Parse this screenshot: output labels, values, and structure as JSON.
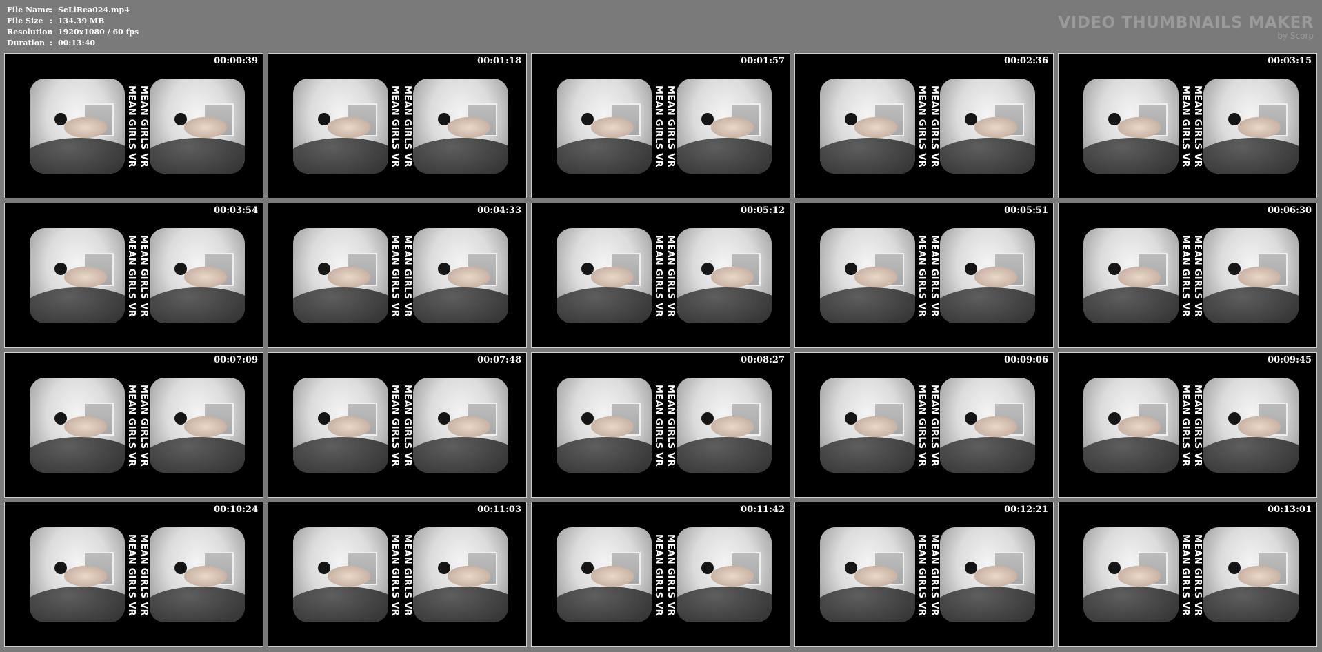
{
  "meta": {
    "rows": [
      {
        "key": "File Name",
        "sep": ":",
        "value": "SeLiRea024.mp4"
      },
      {
        "key": "File Size",
        "sep": ":",
        "value": "134.39 MB"
      },
      {
        "key": "Resolution",
        "sep": ":",
        "value": "1920x1080 / 60 fps"
      },
      {
        "key": "Duration",
        "sep": ":",
        "value": "00:13:40"
      }
    ]
  },
  "brand": {
    "title": "VIDEO THUMBNAILS MAKER",
    "subtitle": "by Scorp"
  },
  "thumbnails": [
    {
      "time": "00:00:39",
      "watermark": "MEAN GIRLS VR"
    },
    {
      "time": "00:01:18",
      "watermark": "MEAN GIRLS VR"
    },
    {
      "time": "00:01:57",
      "watermark": "MEAN GIRLS VR"
    },
    {
      "time": "00:02:36",
      "watermark": "MEAN GIRLS VR"
    },
    {
      "time": "00:03:15",
      "watermark": "MEAN GIRLS VR"
    },
    {
      "time": "00:03:54",
      "watermark": "MEAN GIRLS VR"
    },
    {
      "time": "00:04:33",
      "watermark": "MEAN GIRLS VR"
    },
    {
      "time": "00:05:12",
      "watermark": "MEAN GIRLS VR"
    },
    {
      "time": "00:05:51",
      "watermark": "MEAN GIRLS VR"
    },
    {
      "time": "00:06:30",
      "watermark": "MEAN GIRLS VR"
    },
    {
      "time": "00:07:09",
      "watermark": "MEAN GIRLS VR"
    },
    {
      "time": "00:07:48",
      "watermark": "MEAN GIRLS VR"
    },
    {
      "time": "00:08:27",
      "watermark": "MEAN GIRLS VR"
    },
    {
      "time": "00:09:06",
      "watermark": "MEAN GIRLS VR"
    },
    {
      "time": "00:09:45",
      "watermark": "MEAN GIRLS VR"
    },
    {
      "time": "00:10:24",
      "watermark": "MEAN GIRLS VR"
    },
    {
      "time": "00:11:03",
      "watermark": "MEAN GIRLS VR"
    },
    {
      "time": "00:11:42",
      "watermark": "MEAN GIRLS VR"
    },
    {
      "time": "00:12:21",
      "watermark": "MEAN GIRLS VR"
    },
    {
      "time": "00:13:01",
      "watermark": "MEAN GIRLS VR"
    }
  ]
}
